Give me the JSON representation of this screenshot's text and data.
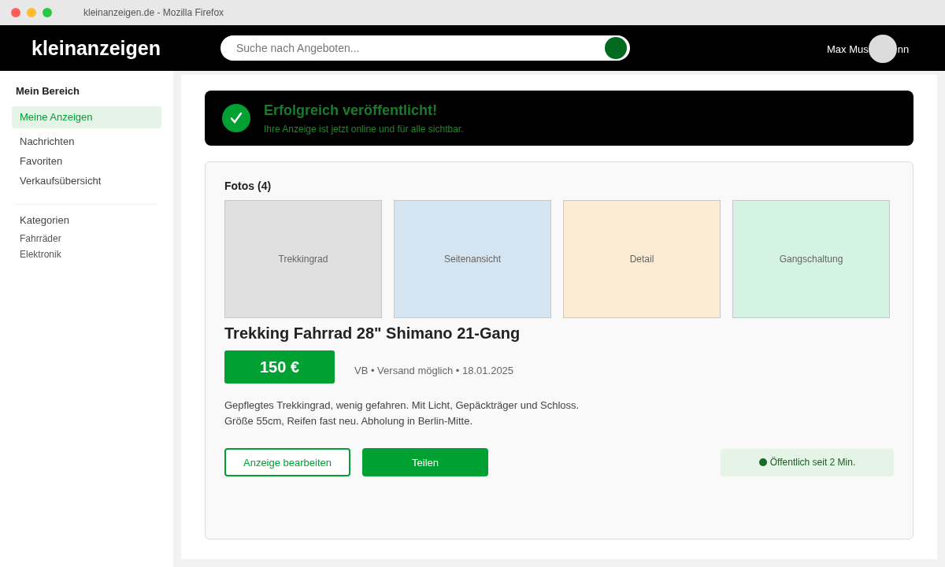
{
  "window": {
    "title": "kleinanzeigen.de - Mozilla Firefox"
  },
  "header": {
    "logo": "kleinanzeigen",
    "search": {
      "placeholder": "Suche nach Angeboten..."
    },
    "user_name_parts": [
      "Max Mus",
      "nn"
    ]
  },
  "sidebar": {
    "heading": "Mein Bereich",
    "items": [
      {
        "label": "Meine Anzeigen",
        "selected": true
      },
      {
        "label": "Nachrichten",
        "selected": false
      },
      {
        "label": "Favoriten",
        "selected": false
      },
      {
        "label": "Verkaufsübersicht",
        "selected": false
      }
    ],
    "categories_heading": "Kategorien",
    "categories": [
      "Fahrräder",
      "Elektronik"
    ]
  },
  "banner": {
    "title": "Erfolgreich veröffentlicht!",
    "text": "Ihre Anzeige ist jetzt online und für alle sichtbar."
  },
  "listing": {
    "photos_label": "Fotos (4)",
    "photos": [
      {
        "label": "Trekkingrad",
        "color": "#e0e0e0"
      },
      {
        "label": "Seitenansicht",
        "color": "#d4e4f0"
      },
      {
        "label": "Detail",
        "color": "#fbebd2"
      },
      {
        "label": "Gangschaltung",
        "color": "#d4f3e2"
      }
    ],
    "title": "Trekking Fahrrad 28\" Shimano 21-Gang",
    "price": "150 €",
    "meta": "VB • Versand möglich • 18.01.2025",
    "description": [
      "Gepflegtes Trekkingrad, wenig gefahren. Mit Licht, Gepäckträger und Schloss.",
      "Größe 55cm, Reifen fast neu. Abholung in Berlin-Mitte."
    ],
    "buttons": [
      {
        "label": "Anzeige bearbeiten",
        "kind": "outline"
      },
      {
        "label": "Teilen",
        "kind": "filled"
      }
    ],
    "status": "Öffentlich seit 2 Min."
  }
}
